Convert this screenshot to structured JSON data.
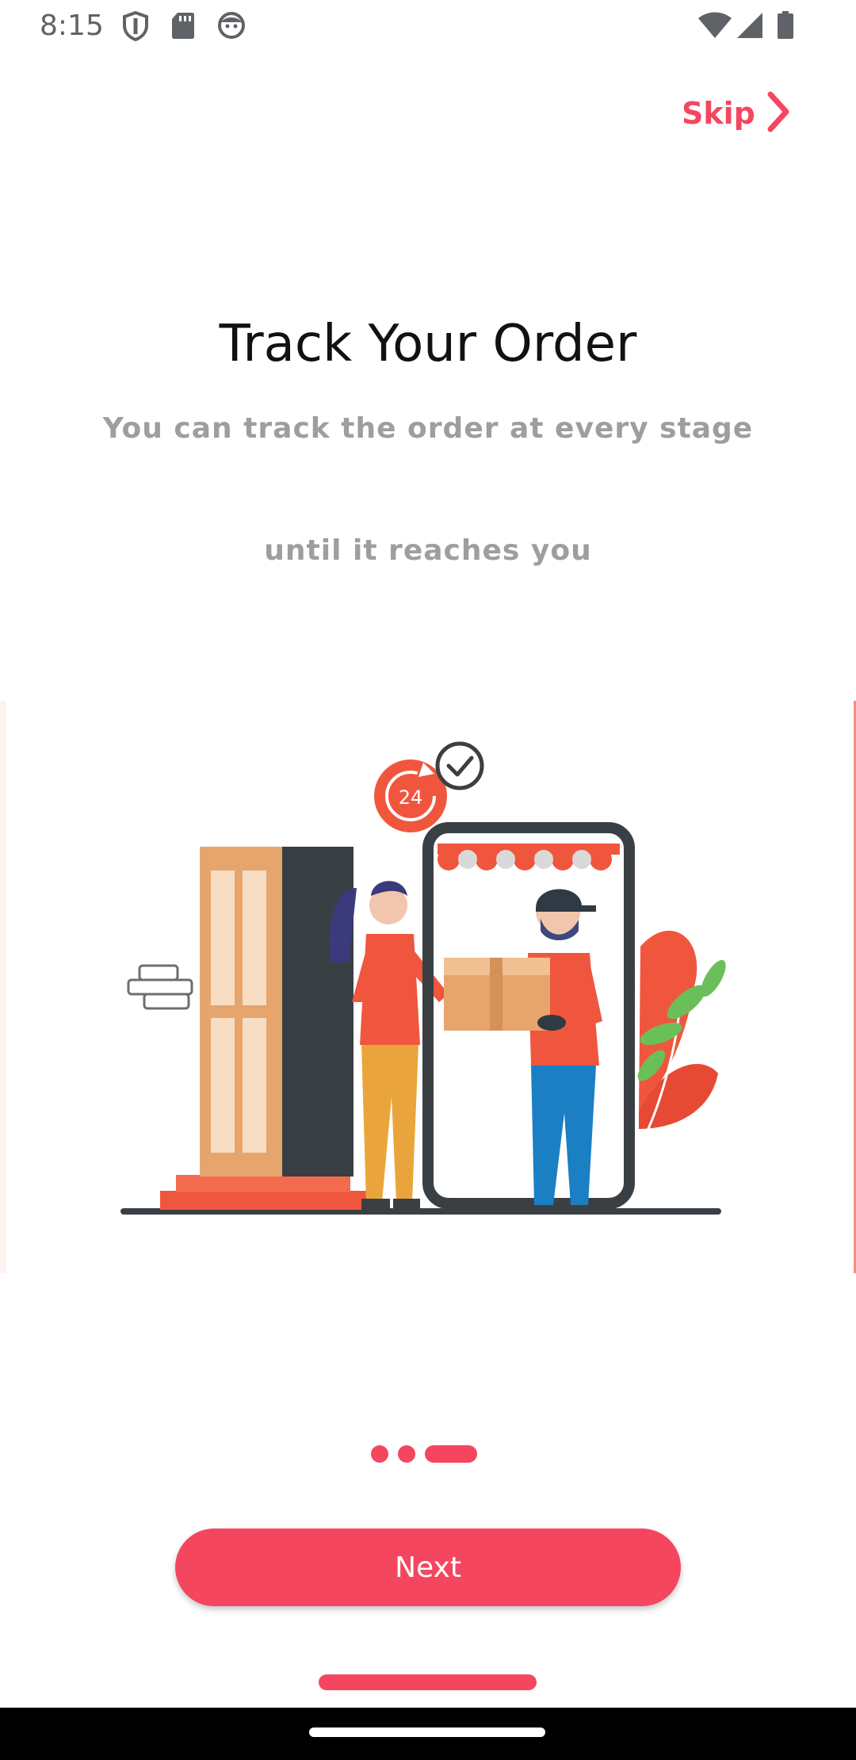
{
  "status_bar": {
    "time": "8:15",
    "left_icons": [
      "shield-icon",
      "sd-card-icon",
      "face-icon"
    ],
    "right_icons": [
      "wifi-icon",
      "signal-icon",
      "battery-icon"
    ]
  },
  "skip": {
    "label": "Skip",
    "icon": "chevron-right-icon",
    "color": "#f4475f"
  },
  "onboarding": {
    "title": "Track Your Order",
    "subtitle_line1": "You can track the order at every stage",
    "subtitle_line2": "until it reaches you"
  },
  "illustration": {
    "name": "delivery-illustration",
    "badge_text": "24"
  },
  "pager": {
    "total": 3,
    "active_index": 2
  },
  "next_button": {
    "label": "Next",
    "color": "#f4475f"
  }
}
